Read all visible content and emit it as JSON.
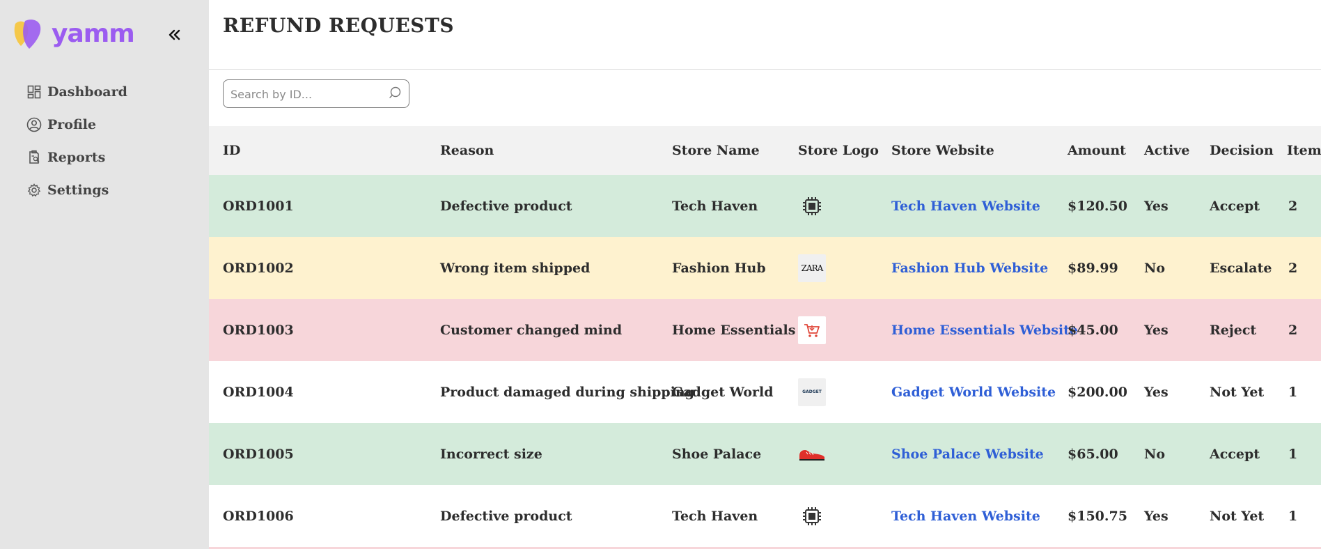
{
  "brand": {
    "name": "yamm",
    "color": "#9b5cf0"
  },
  "nav": [
    {
      "label": "Dashboard",
      "icon": "dashboard-icon"
    },
    {
      "label": "Profile",
      "icon": "user-circle-icon"
    },
    {
      "label": "Reports",
      "icon": "report-icon"
    },
    {
      "label": "Settings",
      "icon": "gear-icon"
    }
  ],
  "page": {
    "title": "REFUND REQUESTS"
  },
  "search": {
    "placeholder": "Search by ID...",
    "value": ""
  },
  "table": {
    "columns": [
      "ID",
      "Reason",
      "Store Name",
      "Store Logo",
      "Store Website",
      "Amount",
      "Active",
      "Decision",
      "Items"
    ],
    "rows": [
      {
        "id": "ORD1001",
        "reason": "Defective product",
        "store": "Tech Haven",
        "logo": "chip-logo",
        "website": "Tech Haven Website",
        "amount": "$120.50",
        "active": "Yes",
        "decision": "Accept",
        "items": "2",
        "bg": "#d4ebdb"
      },
      {
        "id": "ORD1002",
        "reason": "Wrong item shipped",
        "store": "Fashion Hub",
        "logo": "zara-logo",
        "logo_text": "ZARA",
        "website": "Fashion Hub Website",
        "amount": "$89.99",
        "active": "No",
        "decision": "Escalate",
        "items": "2",
        "bg": "#fef2cf"
      },
      {
        "id": "ORD1003",
        "reason": "Customer changed mind",
        "store": "Home Essentials",
        "logo": "cart-logo",
        "website": "Home Essentials Website",
        "amount": "$45.00",
        "active": "Yes",
        "decision": "Reject",
        "items": "2",
        "bg": "#f7d6da"
      },
      {
        "id": "ORD1004",
        "reason": "Product damaged during shipping",
        "store": "Gadget World",
        "logo": "gadget-logo",
        "logo_text": "GADGET",
        "website": "Gadget World Website",
        "amount": "$200.00",
        "active": "Yes",
        "decision": "Not Yet",
        "items": "1",
        "bg": "#ffffff"
      },
      {
        "id": "ORD1005",
        "reason": "Incorrect size",
        "store": "Shoe Palace",
        "logo": "sneaker-logo",
        "website": "Shoe Palace Website",
        "amount": "$65.00",
        "active": "No",
        "decision": "Accept",
        "items": "1",
        "bg": "#d4ebdb"
      },
      {
        "id": "ORD1006",
        "reason": "Defective product",
        "store": "Tech Haven",
        "logo": "chip-logo",
        "website": "Tech Haven Website",
        "amount": "$150.75",
        "active": "Yes",
        "decision": "Not Yet",
        "items": "1",
        "bg": "#ffffff"
      }
    ]
  },
  "colors": {
    "sidebar_bg": "#e5e5e5",
    "header_bg": "#f2f2f2",
    "link": "#2f5fd6"
  }
}
